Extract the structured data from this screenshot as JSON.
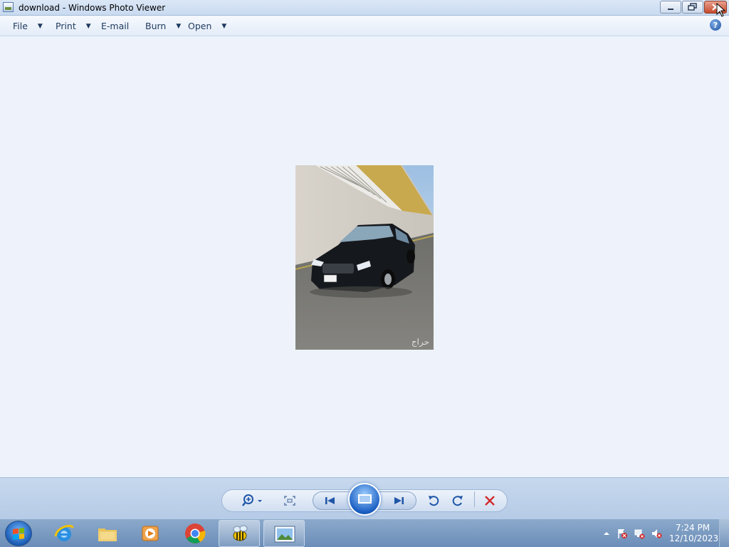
{
  "window": {
    "title": "download - Windows Photo Viewer"
  },
  "menu": {
    "items": [
      {
        "label": "File",
        "has_dropdown": true
      },
      {
        "label": "Print",
        "has_dropdown": true
      },
      {
        "label": "E-mail",
        "has_dropdown": false
      },
      {
        "label": "Burn",
        "has_dropdown": true
      },
      {
        "label": "Open",
        "has_dropdown": true
      }
    ],
    "help_label": "?"
  },
  "controls": {
    "buttons": [
      "zoom",
      "actual-size",
      "previous",
      "slideshow",
      "next",
      "rotate-counterclockwise",
      "rotate-clockwise",
      "delete"
    ]
  },
  "photo": {
    "watermark": "حراج"
  },
  "taskbar": {
    "pinned": [
      "start",
      "internet-explorer",
      "windows-explorer",
      "media-player",
      "chrome",
      "bee-app",
      "photo-viewer"
    ],
    "clock_time": "7:24 PM",
    "clock_date": "12/10/2023"
  },
  "colors": {
    "accent": "#1f55a8",
    "delete": "#d22b2b",
    "viewer_bg": "#eef3fb"
  }
}
